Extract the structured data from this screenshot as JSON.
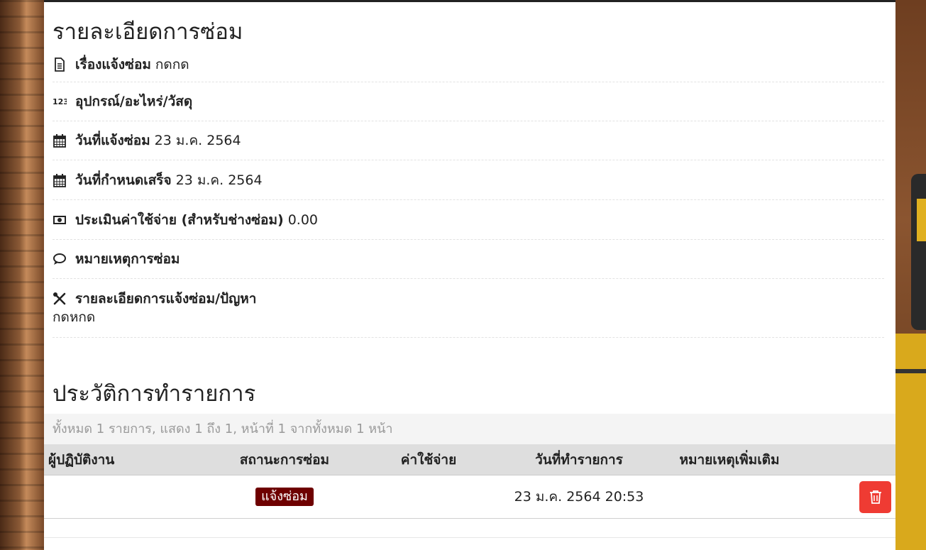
{
  "detail": {
    "title": "รายละเอียดการซ่อม",
    "rows": [
      {
        "icon": "document-icon",
        "label": "เรื่องแจ้งซ่อม",
        "value": "กดกด"
      },
      {
        "icon": "numbers-icon",
        "label": "อุปกรณ์/อะไหร่/วัสดุ",
        "value": ""
      },
      {
        "icon": "calendar-icon",
        "label": "วันที่แจ้งซ่อม",
        "value": "23 ม.ค. 2564"
      },
      {
        "icon": "calendar-icon",
        "label": "วันที่กำหนดเสร็จ",
        "value": "23 ม.ค. 2564"
      },
      {
        "icon": "money-icon",
        "label": "ประเมินค่าใช้จ่าย (สำหรับช่างซ่อม)",
        "value": "0.00"
      },
      {
        "icon": "comment-icon",
        "label": "หมายเหตุการซ่อม",
        "value": ""
      },
      {
        "icon": "tools-icon",
        "label": "รายละเอียดการแจ้งซ่อม/ปัญหา",
        "value": "กดหกด"
      }
    ]
  },
  "history": {
    "title": "ประวัติการทำรายการ",
    "summary": "ทั้งหมด 1 รายการ, แสดง 1 ถึง 1, หน้าที่ 1 จากทั้งหมด 1 หน้า",
    "columns": [
      "ผู้ปฏิบัติงาน",
      "สถานะการซ่อม",
      "ค่าใช้จ่าย",
      "วันที่ทำรายการ",
      "หมายเหตุเพิ่มเติม"
    ],
    "rows": [
      {
        "operator": "",
        "status": "แจ้งซ่อม",
        "cost": "",
        "date": "23 ม.ค. 2564 20:53",
        "note": ""
      }
    ]
  },
  "colors": {
    "status_badge": "#6e0000",
    "delete_button": "#ef3b33"
  },
  "icons": {
    "delete": "trash-icon"
  }
}
